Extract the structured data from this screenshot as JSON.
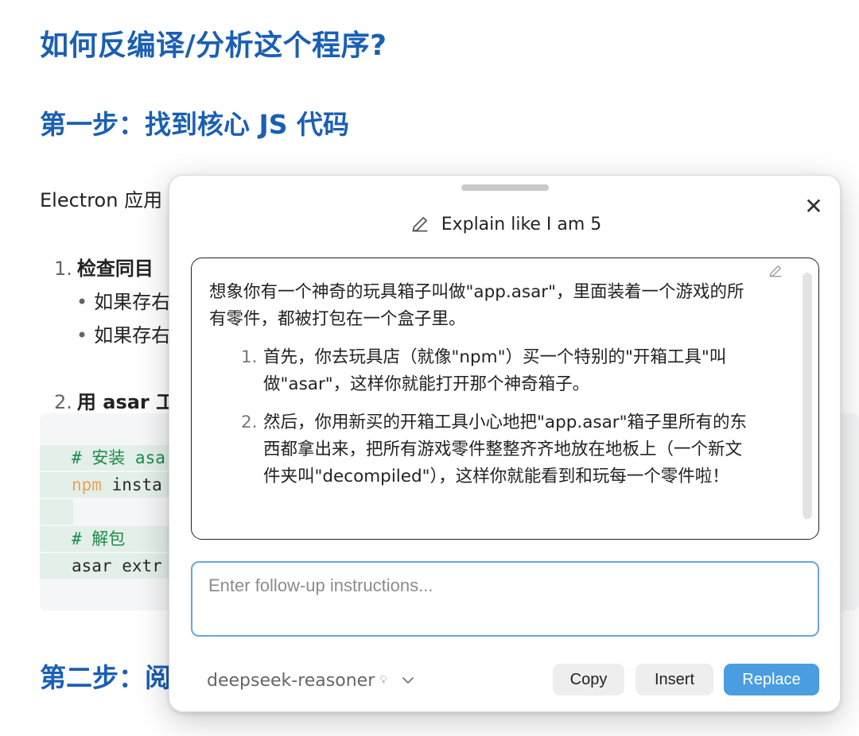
{
  "document": {
    "heading": "如何反编译/分析这个程序?",
    "step1_heading": "第一步：找到核心 JS 代码",
    "intro_partial": "Electron 应用",
    "list": [
      {
        "num": "1.",
        "label": "检查同目"
      },
      {
        "num": "2.",
        "label": "用 asar 工"
      }
    ],
    "bullets": [
      "如果存右",
      "如果存右"
    ],
    "code": [
      {
        "kind": "comment",
        "text": "# 安装 asa"
      },
      {
        "kind": "cmd",
        "cmd": "npm",
        "rest": " insta"
      },
      {
        "kind": "blank",
        "text": ""
      },
      {
        "kind": "comment",
        "text": "# 解包"
      },
      {
        "kind": "plain",
        "text": "asar extr"
      }
    ],
    "step2_heading": "第二步：阅"
  },
  "popup": {
    "title": "Explain like I am 5",
    "result": {
      "paragraph": "想象你有一个神奇的玩具箱子叫做\"app.asar\"，里面装着一个游戏的所有零件，都被打包在一个盒子里。",
      "items": [
        {
          "num": "1.",
          "text": "首先，你去玩具店（就像\"npm\"）买一个特别的\"开箱工具\"叫做\"asar\"，这样你就能打开那个神奇箱子。"
        },
        {
          "num": "2.",
          "text": "然后，你用新买的开箱工具小心地把\"app.asar\"箱子里所有的东西都拿出来，把所有游戏零件整整齐齐地放在地板上（一个新文件夹叫\"decompiled\"），这样你就能看到和玩每一个零件啦！"
        }
      ]
    },
    "followup_placeholder": "Enter follow-up instructions...",
    "model": "deepseek-reasoner",
    "model_icon": "lightbulb-icon",
    "buttons": {
      "copy": "Copy",
      "insert": "Insert",
      "replace": "Replace"
    },
    "colors": {
      "accent": "#4a9de0",
      "heading": "#1a5fb4",
      "focus_border": "#6ba6d8"
    }
  }
}
